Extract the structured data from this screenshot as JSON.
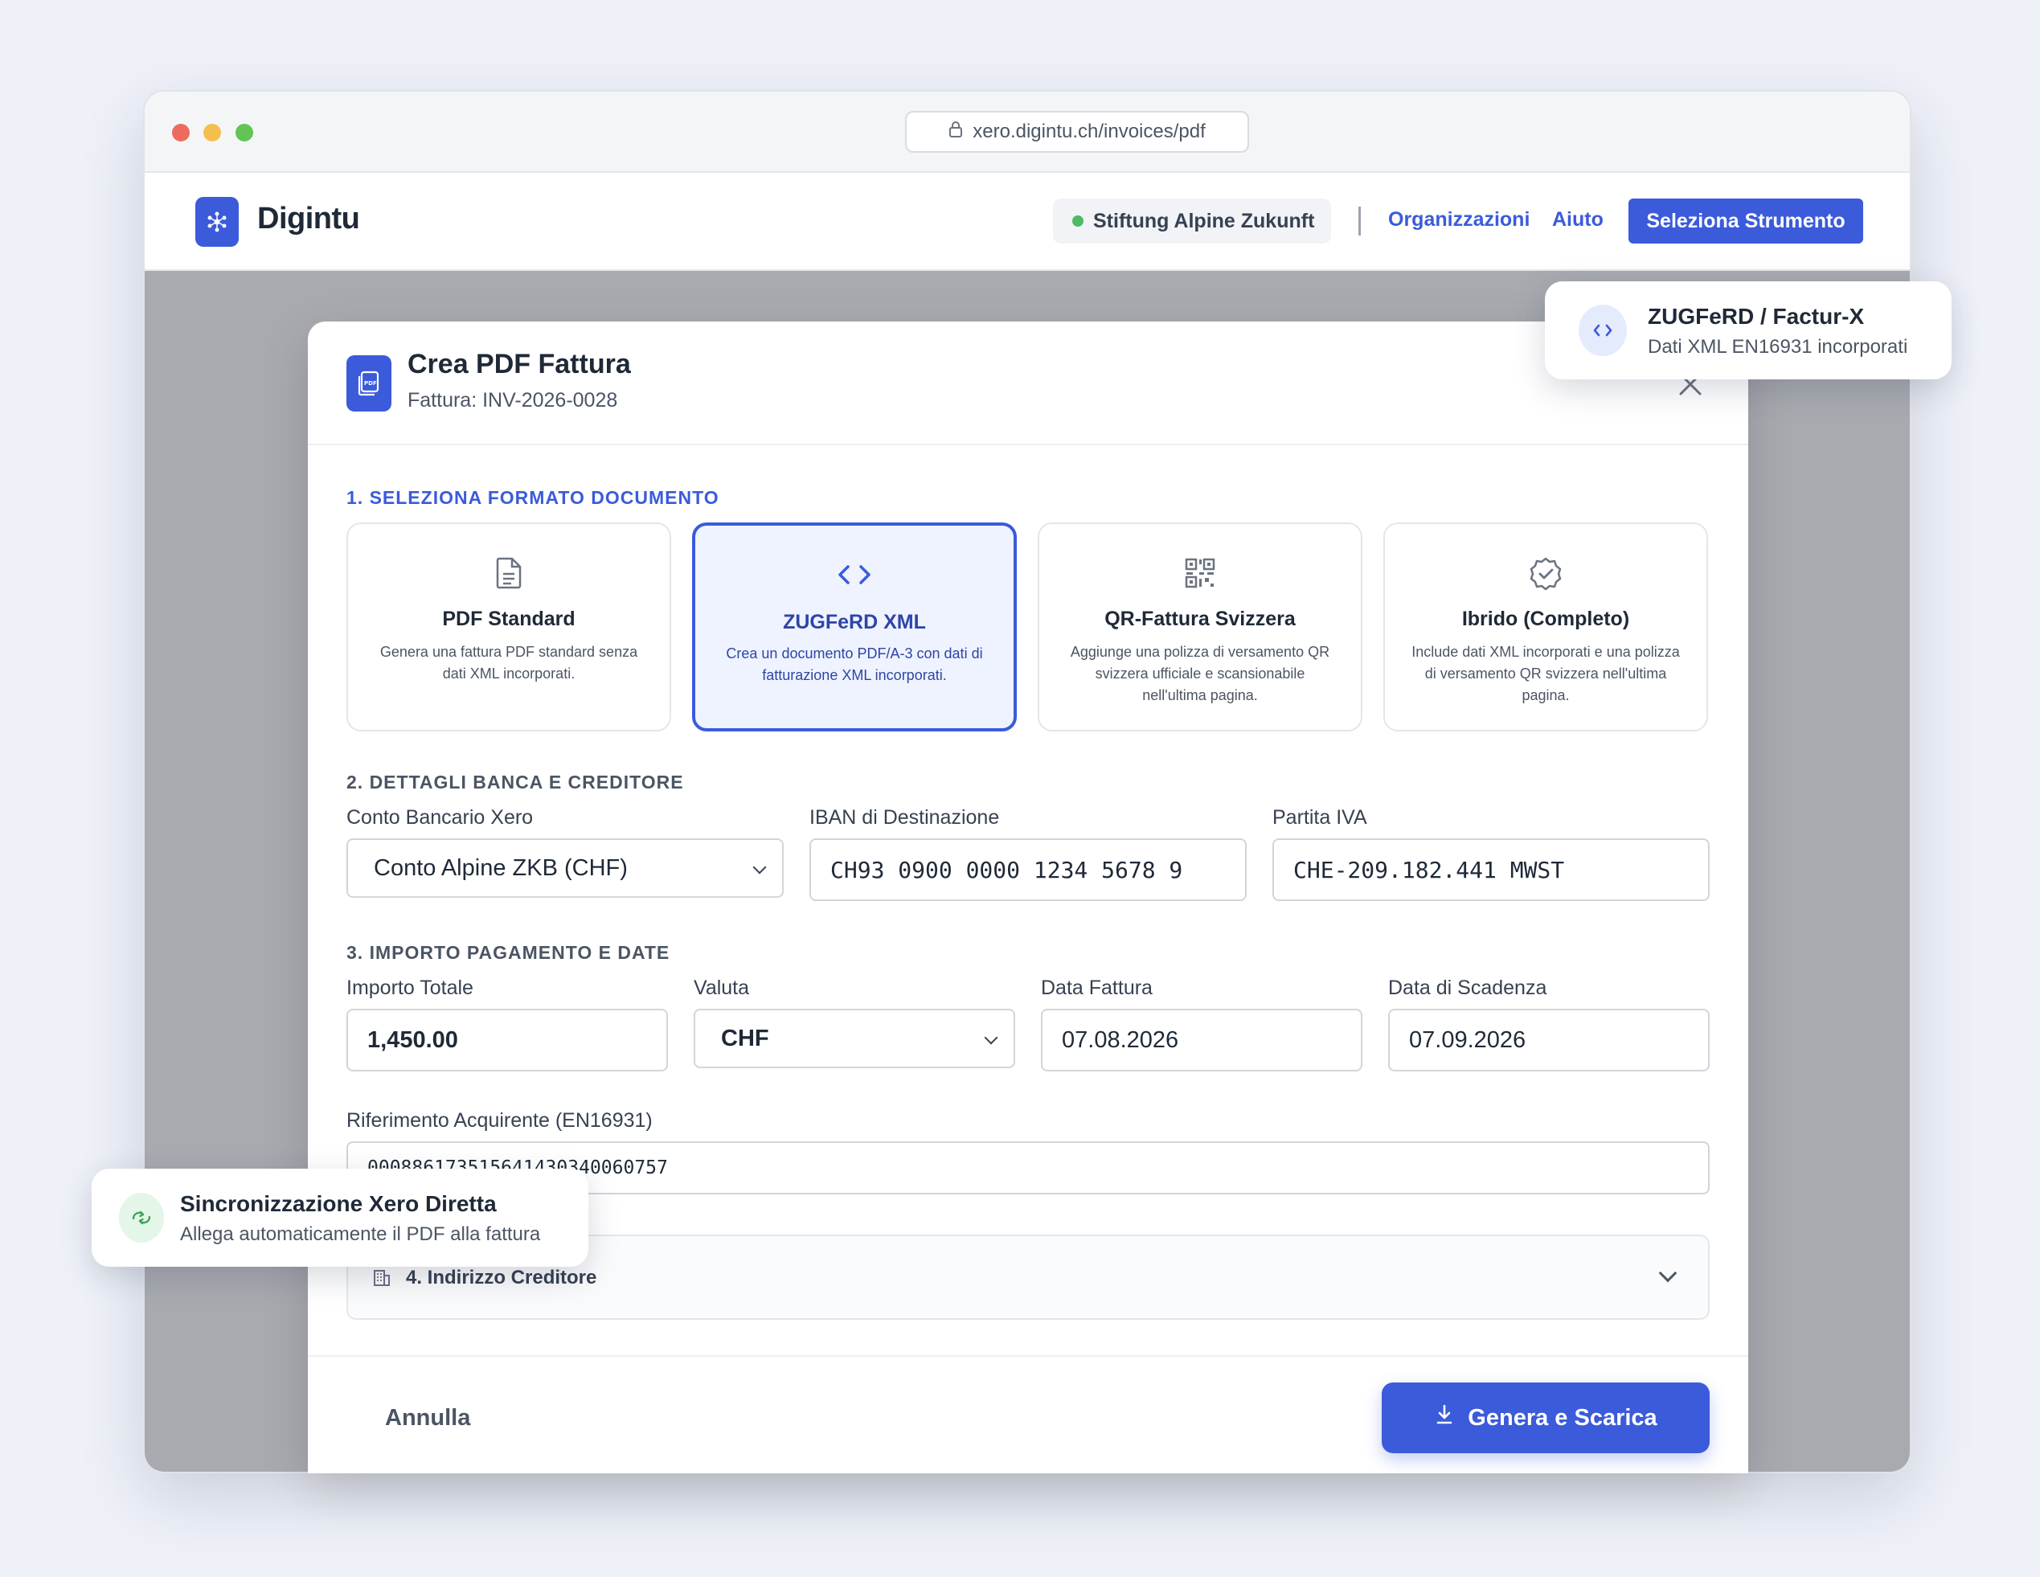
{
  "browser": {
    "url": "xero.digintu.ch/invoices/pdf"
  },
  "appbar": {
    "brand": "Digintu",
    "organization": "Stiftung Alpine Zukunft",
    "nav_organizations": "Organizzazioni",
    "nav_help": "Aiuto",
    "select_tool_button": "Seleziona Strumento"
  },
  "modal": {
    "title": "Crea PDF Fattura",
    "subtitle": "Fattura: INV-2026-0028",
    "section1_label": "1. SELEZIONA FORMATO DOCUMENTO",
    "formats": [
      {
        "title": "PDF Standard",
        "desc": "Genera una fattura PDF standard senza dati XML incorporati.",
        "icon": "document-icon",
        "selected": false
      },
      {
        "title": "ZUGFeRD XML",
        "desc": "Crea un documento PDF/A-3 con dati di fatturazione XML incorporati.",
        "icon": "code-icon",
        "selected": true
      },
      {
        "title": "QR-Fattura Svizzera",
        "desc": "Aggiunge una polizza di versamento QR svizzera ufficiale e scansionabile nell'ultima pagina.",
        "icon": "qr-code-icon",
        "selected": false
      },
      {
        "title": "Ibrido (Completo)",
        "desc": "Include dati XML incorporati e una polizza di versamento QR svizzera nell'ultima pagina.",
        "icon": "verified-badge-icon",
        "selected": false
      }
    ],
    "section2_label": "2. DETTAGLI BANCA E CREDITORE",
    "bank_account_label": "Conto Bancario Xero",
    "bank_account_value": "Conto Alpine ZKB (CHF)",
    "iban_label": "IBAN di Destinazione",
    "iban_value": "CH93 0900 0000 1234 5678 9",
    "vat_label": "Partita IVA",
    "vat_value": "CHE-209.182.441 MWST",
    "section3_label": "3. IMPORTO PAGAMENTO E DATE",
    "amount_label": "Importo Totale",
    "amount_value": "1,450.00",
    "currency_label": "Valuta",
    "currency_value": "CHF",
    "invoice_date_label": "Data Fattura",
    "invoice_date_value": "07.08.2026",
    "due_date_label": "Data di Scadenza",
    "due_date_value": "07.09.2026",
    "buyer_ref_label": "Riferimento Acquirente (EN16931)",
    "buyer_ref_value": "000886173515641430340060757",
    "section4_label": "4. Indirizzo Creditore",
    "cancel_button": "Annulla",
    "generate_button": "Genera e Scarica"
  },
  "toasts": {
    "zugferd_title": "ZUGFeRD / Factur-X",
    "zugferd_sub": "Dati XML EN16931 incorporati",
    "sync_title": "Sincronizzazione Xero Diretta",
    "sync_sub": "Allega automaticamente il PDF alla fattura"
  },
  "colors": {
    "accent": "#3b5bdb",
    "status_green": "#4cbb63",
    "overlay": "#a8aab0"
  }
}
